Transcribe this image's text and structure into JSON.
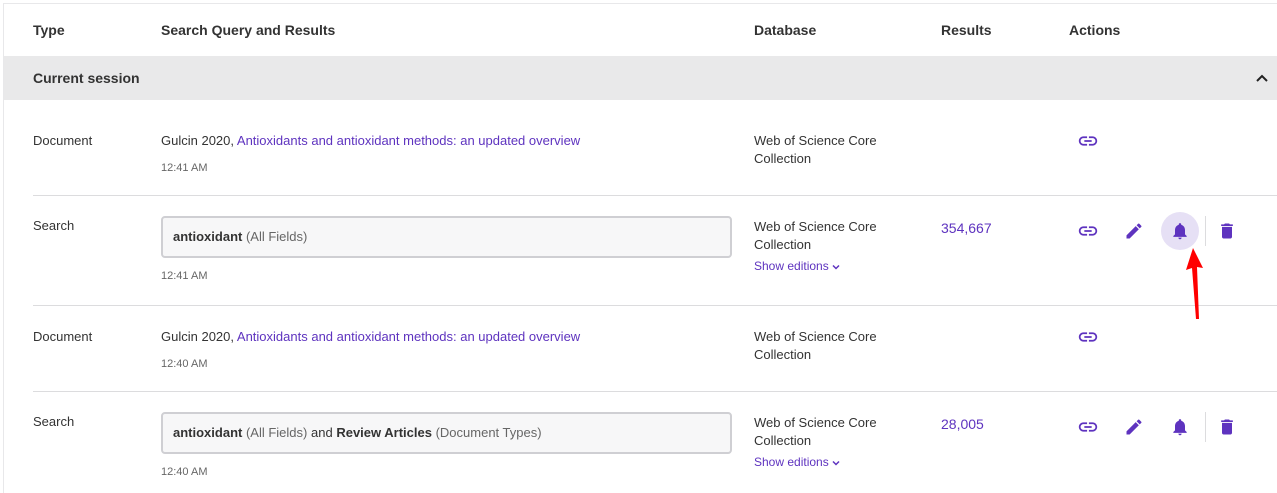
{
  "header": {
    "type": "Type",
    "query": "Search Query and Results",
    "database": "Database",
    "results": "Results",
    "actions": "Actions"
  },
  "session": {
    "label": "Current session"
  },
  "rows": [
    {
      "type": "Document",
      "prefix": "Gulcin 2020,",
      "link": "Antioxidants and antioxidant methods: an updated overview",
      "time": "12:41 AM",
      "db_line1": "Web of Science Core",
      "db_line2": "Collection"
    },
    {
      "type": "Search",
      "query_term1": "antioxidant",
      "query_field1": "(All Fields)",
      "time": "12:41 AM",
      "db_line1": "Web of Science Core",
      "db_line2": "Collection",
      "show_editions": "Show editions",
      "results": "354,667"
    },
    {
      "type": "Document",
      "prefix": "Gulcin 2020,",
      "link": "Antioxidants and antioxidant methods: an updated overview",
      "time": "12:40 AM",
      "db_line1": "Web of Science Core",
      "db_line2": "Collection"
    },
    {
      "type": "Search",
      "query_term1": "antioxidant",
      "query_field1": "(All Fields)",
      "query_and": "and",
      "query_term2": "Review Articles",
      "query_field2": "(Document Types)",
      "time": "12:40 AM",
      "db_line1": "Web of Science Core",
      "db_line2": "Collection",
      "show_editions": "Show editions",
      "results": "28,005"
    }
  ],
  "icons": {
    "link": "link-icon",
    "edit": "pencil-icon",
    "alert": "bell-icon",
    "delete": "trash-icon",
    "collapse": "chevron-up-icon",
    "expand_small": "chevron-down-icon"
  },
  "colors": {
    "accent": "#5e33bf",
    "session_bar": "#e9e9ea",
    "highlight": "#e6e0f5",
    "annotation_arrow": "#ff0000"
  }
}
